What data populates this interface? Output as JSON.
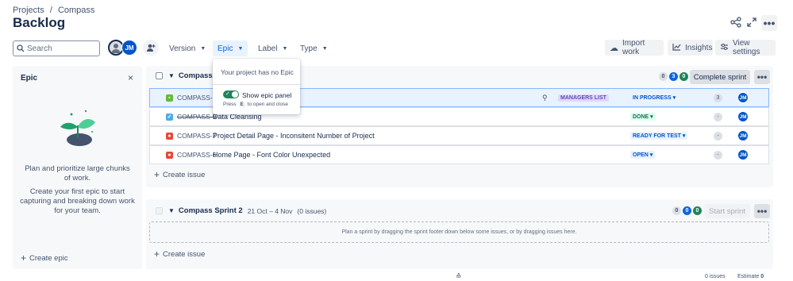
{
  "breadcrumb": {
    "projects": "Projects",
    "separator": "/",
    "project": "Compass"
  },
  "page": {
    "title": "Backlog"
  },
  "header_icons": {
    "share": "share-icon",
    "expand": "expand-icon",
    "more": "•••"
  },
  "search": {
    "placeholder": "Search"
  },
  "avatars": {
    "current_user_initials": "JM"
  },
  "filters": [
    {
      "label": "Version"
    },
    {
      "label": "Epic",
      "active": true
    },
    {
      "label": "Label"
    },
    {
      "label": "Type"
    }
  ],
  "toolbar": {
    "import": "Import work",
    "insights": "Insights",
    "view_settings": "View settings"
  },
  "epic_panel": {
    "title": "Epic",
    "close": "×",
    "description": "Plan and prioritize large chunks of work.",
    "cta_text": "Create your first epic to start capturing and breaking down work for your team.",
    "create": "Create epic"
  },
  "epic_popover": {
    "message": "Your project has no Epic",
    "toggle_label": "Show epic panel",
    "toggle_on": true,
    "hint_press": "Press",
    "hint_key": "E",
    "hint_rest": "to open and close"
  },
  "sprint1": {
    "name": "Compass Sprint",
    "counts": {
      "todo": "0",
      "in_progress": "3",
      "done": "0"
    },
    "action": "Complete sprint",
    "more": "•••",
    "issues": [
      {
        "key": "COMPASS-2",
        "summary": "",
        "type": "story",
        "epic": "MANAGERS LIST",
        "status": "IN PROGRESS",
        "points": "3",
        "assignee": "JM"
      },
      {
        "key": "COMPASS-9",
        "summary": "Data Cleansing",
        "type": "task",
        "status": "DONE",
        "points": "-",
        "assignee": "JM"
      },
      {
        "key": "COMPASS-7",
        "summary": "Project Detail Page - Inconsitent Number of Project",
        "type": "bug",
        "status": "READY FOR TEST",
        "points": "-",
        "assignee": "JM"
      },
      {
        "key": "COMPASS-6",
        "summary": "Home Page - Font Color Unexpected",
        "type": "bug",
        "status": "OPEN",
        "points": "-",
        "assignee": "JM"
      }
    ],
    "create_issue": "Create issue"
  },
  "sprint2": {
    "name": "Compass Sprint 2",
    "dates": "21 Oct – 4 Nov",
    "issue_count": "(0 issues)",
    "counts": {
      "todo": "0",
      "in_progress": "0",
      "done": "0"
    },
    "action": "Start sprint",
    "more": "•••",
    "empty_message": "Plan a sprint by dragging the sprint footer down below some issues, or by dragging issues here.",
    "create_issue": "Create issue"
  },
  "footer": {
    "issues": "0 issues",
    "estimate_label": "Estimate",
    "estimate_value": "0"
  },
  "colors": {
    "accent": "#0c66e4",
    "avatar": "#0055cc",
    "done_green": "#1f845a"
  }
}
